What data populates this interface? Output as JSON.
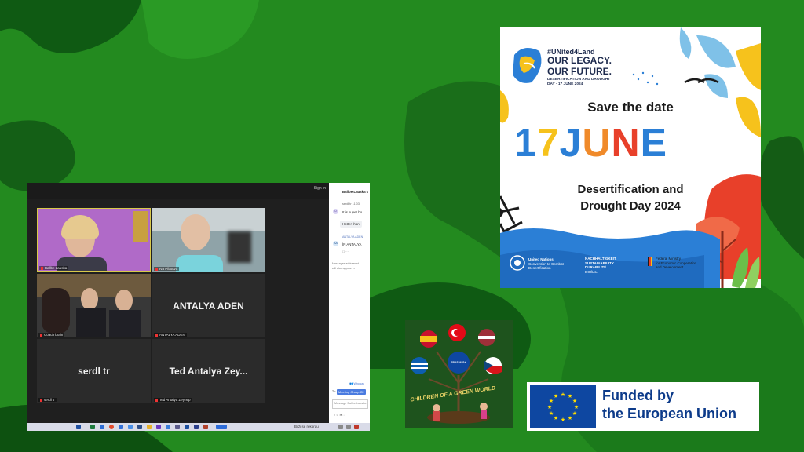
{
  "zoom": {
    "signin": "Sign in",
    "tiles": [
      {
        "name": "Ballbe Lauska"
      },
      {
        "name": "Iva Pilatová"
      },
      {
        "name": "Coach brain"
      },
      {
        "name": "ANTALYA ADEN",
        "big": "ANTALYA ADEN"
      },
      {
        "name": "serdl tr",
        "big": "serdl tr"
      },
      {
        "name": "Ted Antalya Zeynep",
        "big": "Ted Antalya Zey..."
      }
    ],
    "chat": {
      "title": "Ballbe Lauska's",
      "sender1": "serdl tr 11:03",
      "msg1": "It is super ho",
      "msg2": "Hotter than",
      "sender2": "ANTALYA ADEN",
      "msg3": "İN ANTALYA",
      "note": "Messages addressed",
      "note2": "will also appear in",
      "who": "Who ca",
      "to": "To:",
      "group": "Meeting Group Ch",
      "placeholder": "Message Ballbe Lauska"
    },
    "taskbar": {
      "record": "Bilži se rekordu"
    }
  },
  "poster": {
    "hashtag": "#UNited4Land",
    "legacy1": "OUR LEGACY.",
    "legacy2": "OUR FUTURE.",
    "desdate": "DESERTIFICATION AND DROUGHT DAY · 17 JUNE 2024",
    "save": "Save the date",
    "d17": "17",
    "june": "JUNE",
    "line1": "Desertification and",
    "line2": "Drought Day 2024",
    "un1": "United Nations",
    "un2": "Convention to Combat",
    "un3": "Desertification",
    "n1": "NACHHALTIGKEIT.",
    "n2": "SUSTAINABILITY.",
    "n3": "DURABILITÉ.",
    "n4": "DOĞAL",
    "bmz1": "Federal Ministry",
    "bmz2": "for Economic Cooperation",
    "bmz3": "and Development"
  },
  "logo": {
    "caption": "CHILDREN OF A GREEN WORLD",
    "center": "ERASMUS+"
  },
  "eu": {
    "line1": "Funded by",
    "line2": "the European Union"
  },
  "colors": {
    "background": "#238a1f",
    "blue": "#2b7fd6",
    "orange": "#f08a2a",
    "red": "#e8402a",
    "yellow": "#f6c21c",
    "eu_blue": "#0e47a1"
  }
}
